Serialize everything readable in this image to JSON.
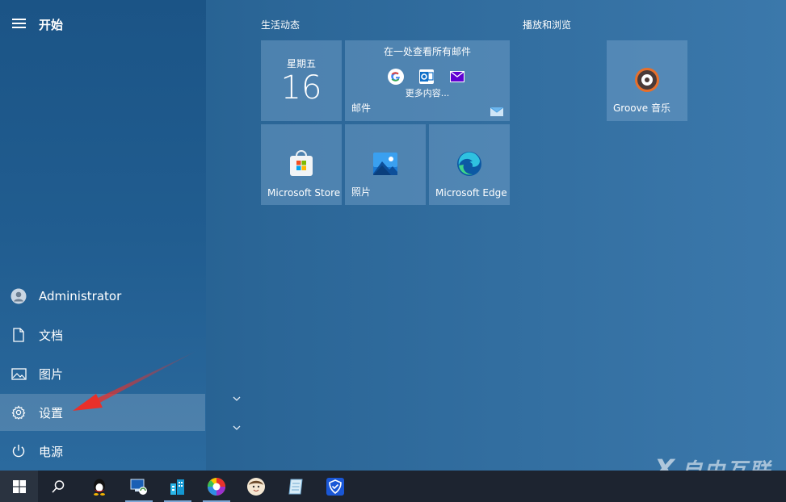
{
  "start": {
    "title": "开始"
  },
  "rail": {
    "items": [
      {
        "label": "Administrator",
        "icon": "user-account-icon"
      },
      {
        "label": "文档",
        "icon": "document-icon"
      },
      {
        "label": "图片",
        "icon": "pictures-icon"
      },
      {
        "label": "设置",
        "icon": "gear-icon"
      },
      {
        "label": "电源",
        "icon": "power-icon"
      }
    ]
  },
  "groups": {
    "life": {
      "title": "生活动态"
    },
    "play": {
      "title": "播放和浏览"
    }
  },
  "tiles": {
    "calendar": {
      "weekday": "星期五",
      "day": "16"
    },
    "mail": {
      "headline": "在一处查看所有邮件",
      "more": "更多内容...",
      "label": "邮件"
    },
    "store": {
      "label": "Microsoft Store"
    },
    "photos": {
      "label": "照片"
    },
    "edge": {
      "label": "Microsoft Edge"
    },
    "groove": {
      "label": "Groove 音乐"
    }
  },
  "watermark": {
    "text": "自由互联"
  },
  "colors": {
    "accent": "#2b6697",
    "taskbar": "#1d2430",
    "annotation_arrow": "#e8302a"
  }
}
